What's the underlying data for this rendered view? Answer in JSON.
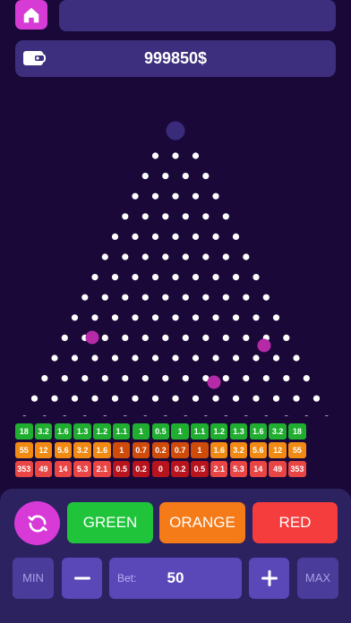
{
  "header": {
    "title": "",
    "home_icon": "home-icon"
  },
  "wallet": {
    "icon": "wallet-icon",
    "balance": "999850$"
  },
  "board": {
    "peg_rows": 16,
    "peg_color": "#ffffff",
    "drop_ball_color": "#3a2a7a",
    "ball_color": "#b62aa8"
  },
  "multipliers": {
    "green": {
      "color": "#1fae30",
      "values": [
        "18",
        "3.2",
        "1.6",
        "1.3",
        "1.2",
        "1.1",
        "1",
        "0.5",
        "1",
        "1.1",
        "1.2",
        "1.3",
        "1.6",
        "3.2",
        "18"
      ]
    },
    "orange": {
      "color": "#f08a12",
      "dark_color": "#cf4b0a",
      "values": [
        "55",
        "12",
        "5.6",
        "3.2",
        "1.6",
        "1",
        "0.7",
        "0.2",
        "0.7",
        "1",
        "1.6",
        "3.2",
        "5.6",
        "12",
        "55"
      ]
    },
    "red": {
      "color": "#e94545",
      "dark_color": "#b8141e",
      "values": [
        "353",
        "49",
        "14",
        "5.3",
        "2.1",
        "0.5",
        "0.2",
        "0",
        "0.2",
        "0.5",
        "2.1",
        "5.3",
        "14",
        "49",
        "353"
      ]
    }
  },
  "controls": {
    "refresh_icon": "refresh-icon",
    "green_label": "GREEN",
    "orange_label": "ORANGE",
    "red_label": "RED",
    "min_label": "MIN",
    "max_label": "MAX",
    "minus_icon": "minus-icon",
    "plus_icon": "plus-icon",
    "bet_label": "Bet:",
    "bet_value": "50"
  }
}
